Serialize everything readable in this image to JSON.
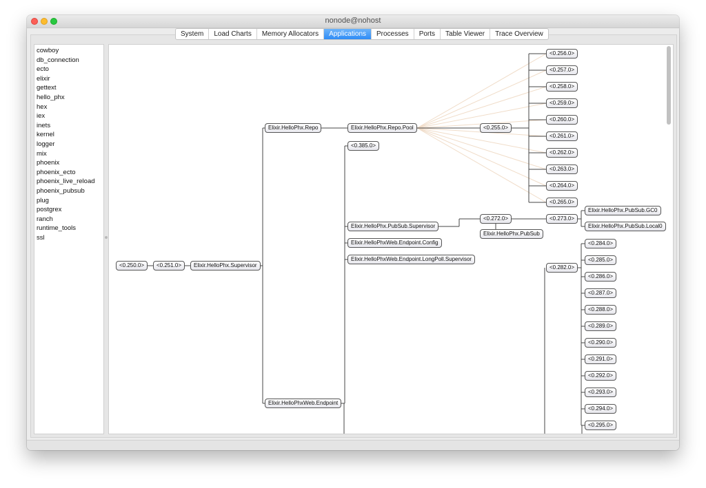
{
  "window": {
    "title": "nonode@nohost"
  },
  "tabs": [
    {
      "label": "System",
      "active": false
    },
    {
      "label": "Load Charts",
      "active": false
    },
    {
      "label": "Memory Allocators",
      "active": false
    },
    {
      "label": "Applications",
      "active": true
    },
    {
      "label": "Processes",
      "active": false
    },
    {
      "label": "Ports",
      "active": false
    },
    {
      "label": "Table Viewer",
      "active": false
    },
    {
      "label": "Trace Overview",
      "active": false
    }
  ],
  "sidebar": {
    "items": [
      "cowboy",
      "db_connection",
      "ecto",
      "elixir",
      "gettext",
      "hello_phx",
      "hex",
      "iex",
      "inets",
      "kernel",
      "logger",
      "mix",
      "phoenix",
      "phoenix_ecto",
      "phoenix_live_reload",
      "phoenix_pubsub",
      "plug",
      "postgrex",
      "ranch",
      "runtime_tools",
      "ssl"
    ]
  },
  "tree": {
    "nodes": {
      "n250": "<0.250.0>",
      "n251": "<0.251.0>",
      "sup": "Elixir.HelloPhx.Supervisor",
      "repo": "Elixir.HelloPhx.Repo",
      "pool": "Elixir.HelloPhx.Repo.Pool",
      "n255": "<0.255.0>",
      "n256": "<0.256.0>",
      "n257": "<0.257.0>",
      "n258": "<0.258.0>",
      "n259": "<0.259.0>",
      "n260": "<0.260.0>",
      "n261": "<0.261.0>",
      "n262": "<0.262.0>",
      "n263": "<0.263.0>",
      "n264": "<0.264.0>",
      "n265": "<0.265.0>",
      "n385": "<0.385.0>",
      "pubsubsup": "Elixir.HelloPhx.PubSub.Supervisor",
      "n272": "<0.272.0>",
      "n273": "<0.273.0>",
      "gc0": "Elixir.HelloPhx.PubSub.GC0",
      "local0": "Elixir.HelloPhx.PubSub.Local0",
      "pubsub": "Elixir.HelloPhx.PubSub",
      "epconfig": "Elixir.HelloPhxWeb.Endpoint.Config",
      "longpoll": "Elixir.HelloPhxWeb.Endpoint.LongPoll.Supervisor",
      "endpoint": "Elixir.HelloPhxWeb.Endpoint",
      "n282": "<0.282.0>",
      "n284": "<0.284.0>",
      "n285": "<0.285.0>",
      "n286": "<0.286.0>",
      "n287": "<0.287.0>",
      "n288": "<0.288.0>",
      "n289": "<0.289.0>",
      "n290": "<0.290.0>",
      "n291": "<0.291.0>",
      "n292": "<0.292.0>",
      "n293": "<0.293.0>",
      "n294": "<0.294.0>",
      "n295": "<0.295.0>"
    },
    "edges": [
      [
        "n250",
        "n251"
      ],
      [
        "n251",
        "sup"
      ],
      [
        "sup",
        "repo"
      ],
      [
        "sup",
        "endpoint"
      ],
      [
        "repo",
        "pool"
      ],
      [
        "pool",
        "n255"
      ],
      [
        "n255",
        "n256"
      ],
      [
        "n255",
        "n257"
      ],
      [
        "n255",
        "n258"
      ],
      [
        "n255",
        "n259"
      ],
      [
        "n255",
        "n260"
      ],
      [
        "n255",
        "n261"
      ],
      [
        "n255",
        "n262"
      ],
      [
        "n255",
        "n263"
      ],
      [
        "n255",
        "n264"
      ],
      [
        "n255",
        "n265"
      ],
      [
        "endpoint",
        "n385"
      ],
      [
        "endpoint",
        "pubsubsup"
      ],
      [
        "endpoint",
        "epconfig"
      ],
      [
        "endpoint",
        "longpoll"
      ],
      [
        "pubsubsup",
        "n272"
      ],
      [
        "n272",
        "n273"
      ],
      [
        "n272",
        "pubsub"
      ],
      [
        "n273",
        "gc0"
      ],
      [
        "n273",
        "local0"
      ],
      [
        "n282",
        "n284"
      ],
      [
        "n282",
        "n285"
      ],
      [
        "n282",
        "n286"
      ],
      [
        "n282",
        "n287"
      ],
      [
        "n282",
        "n288"
      ],
      [
        "n282",
        "n289"
      ],
      [
        "n282",
        "n290"
      ],
      [
        "n282",
        "n291"
      ],
      [
        "n282",
        "n292"
      ],
      [
        "n282",
        "n293"
      ],
      [
        "n282",
        "n294"
      ],
      [
        "n282",
        "n295"
      ]
    ],
    "link_edges": [
      [
        "pool",
        "n256"
      ],
      [
        "pool",
        "n257"
      ],
      [
        "pool",
        "n258"
      ],
      [
        "pool",
        "n259"
      ],
      [
        "pool",
        "n260"
      ],
      [
        "pool",
        "n261"
      ],
      [
        "pool",
        "n262"
      ],
      [
        "pool",
        "n263"
      ],
      [
        "pool",
        "n264"
      ],
      [
        "pool",
        "n265"
      ]
    ],
    "colors": {
      "edge": "#444444",
      "link_edge": "#f0dcc8"
    }
  }
}
